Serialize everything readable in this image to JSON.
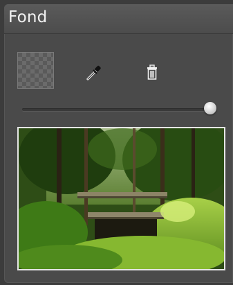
{
  "panel": {
    "title": "Fond"
  },
  "background": {
    "swatch": "transparent",
    "eyedropper_icon": "eyedropper-icon",
    "delete_icon": "trash-icon",
    "opacity_fraction": 0.97,
    "image": "forest-bridge-photo"
  }
}
